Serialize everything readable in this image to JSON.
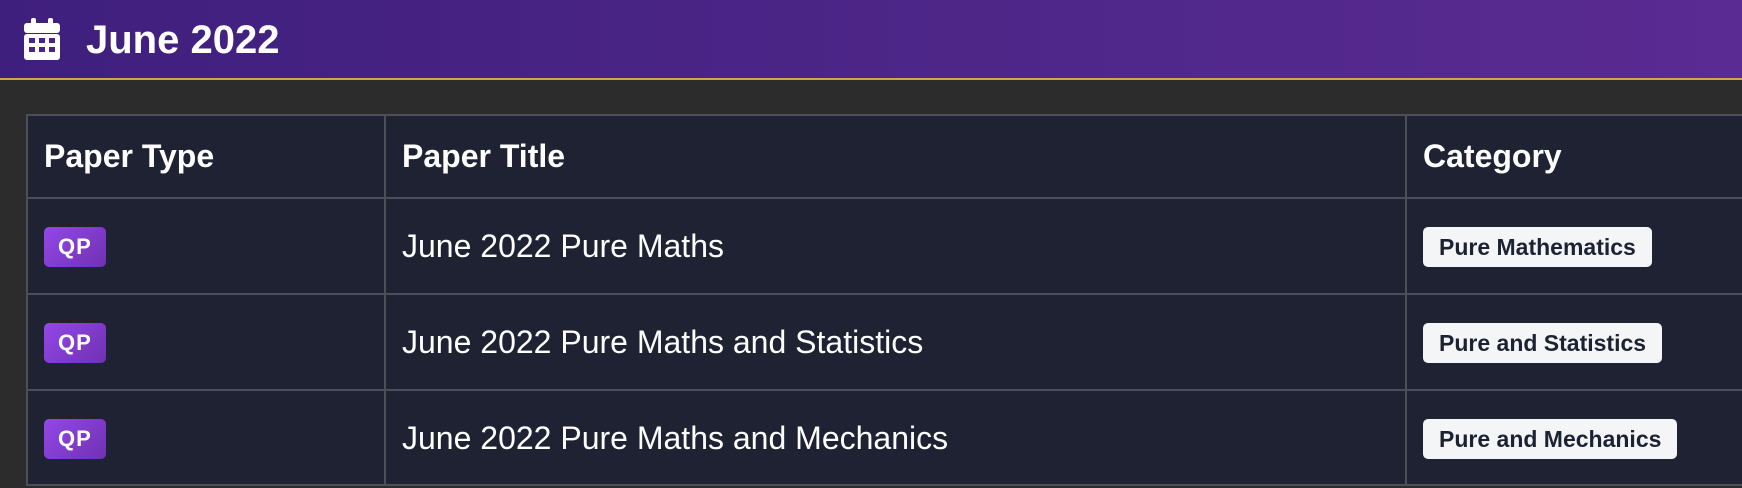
{
  "header": {
    "icon": "calendar-icon",
    "title": "June 2022",
    "accent_color": "#d9a24a"
  },
  "table": {
    "columns": [
      "Paper Type",
      "Paper Title",
      "Category"
    ],
    "rows": [
      {
        "type": "QP",
        "title": "June 2022 Pure Maths",
        "category": "Pure Mathematics"
      },
      {
        "type": "QP",
        "title": "June 2022 Pure Maths and Statistics",
        "category": "Pure and Statistics"
      },
      {
        "type": "QP",
        "title": "June 2022 Pure Maths and Mechanics",
        "category": "Pure and Mechanics"
      }
    ]
  }
}
